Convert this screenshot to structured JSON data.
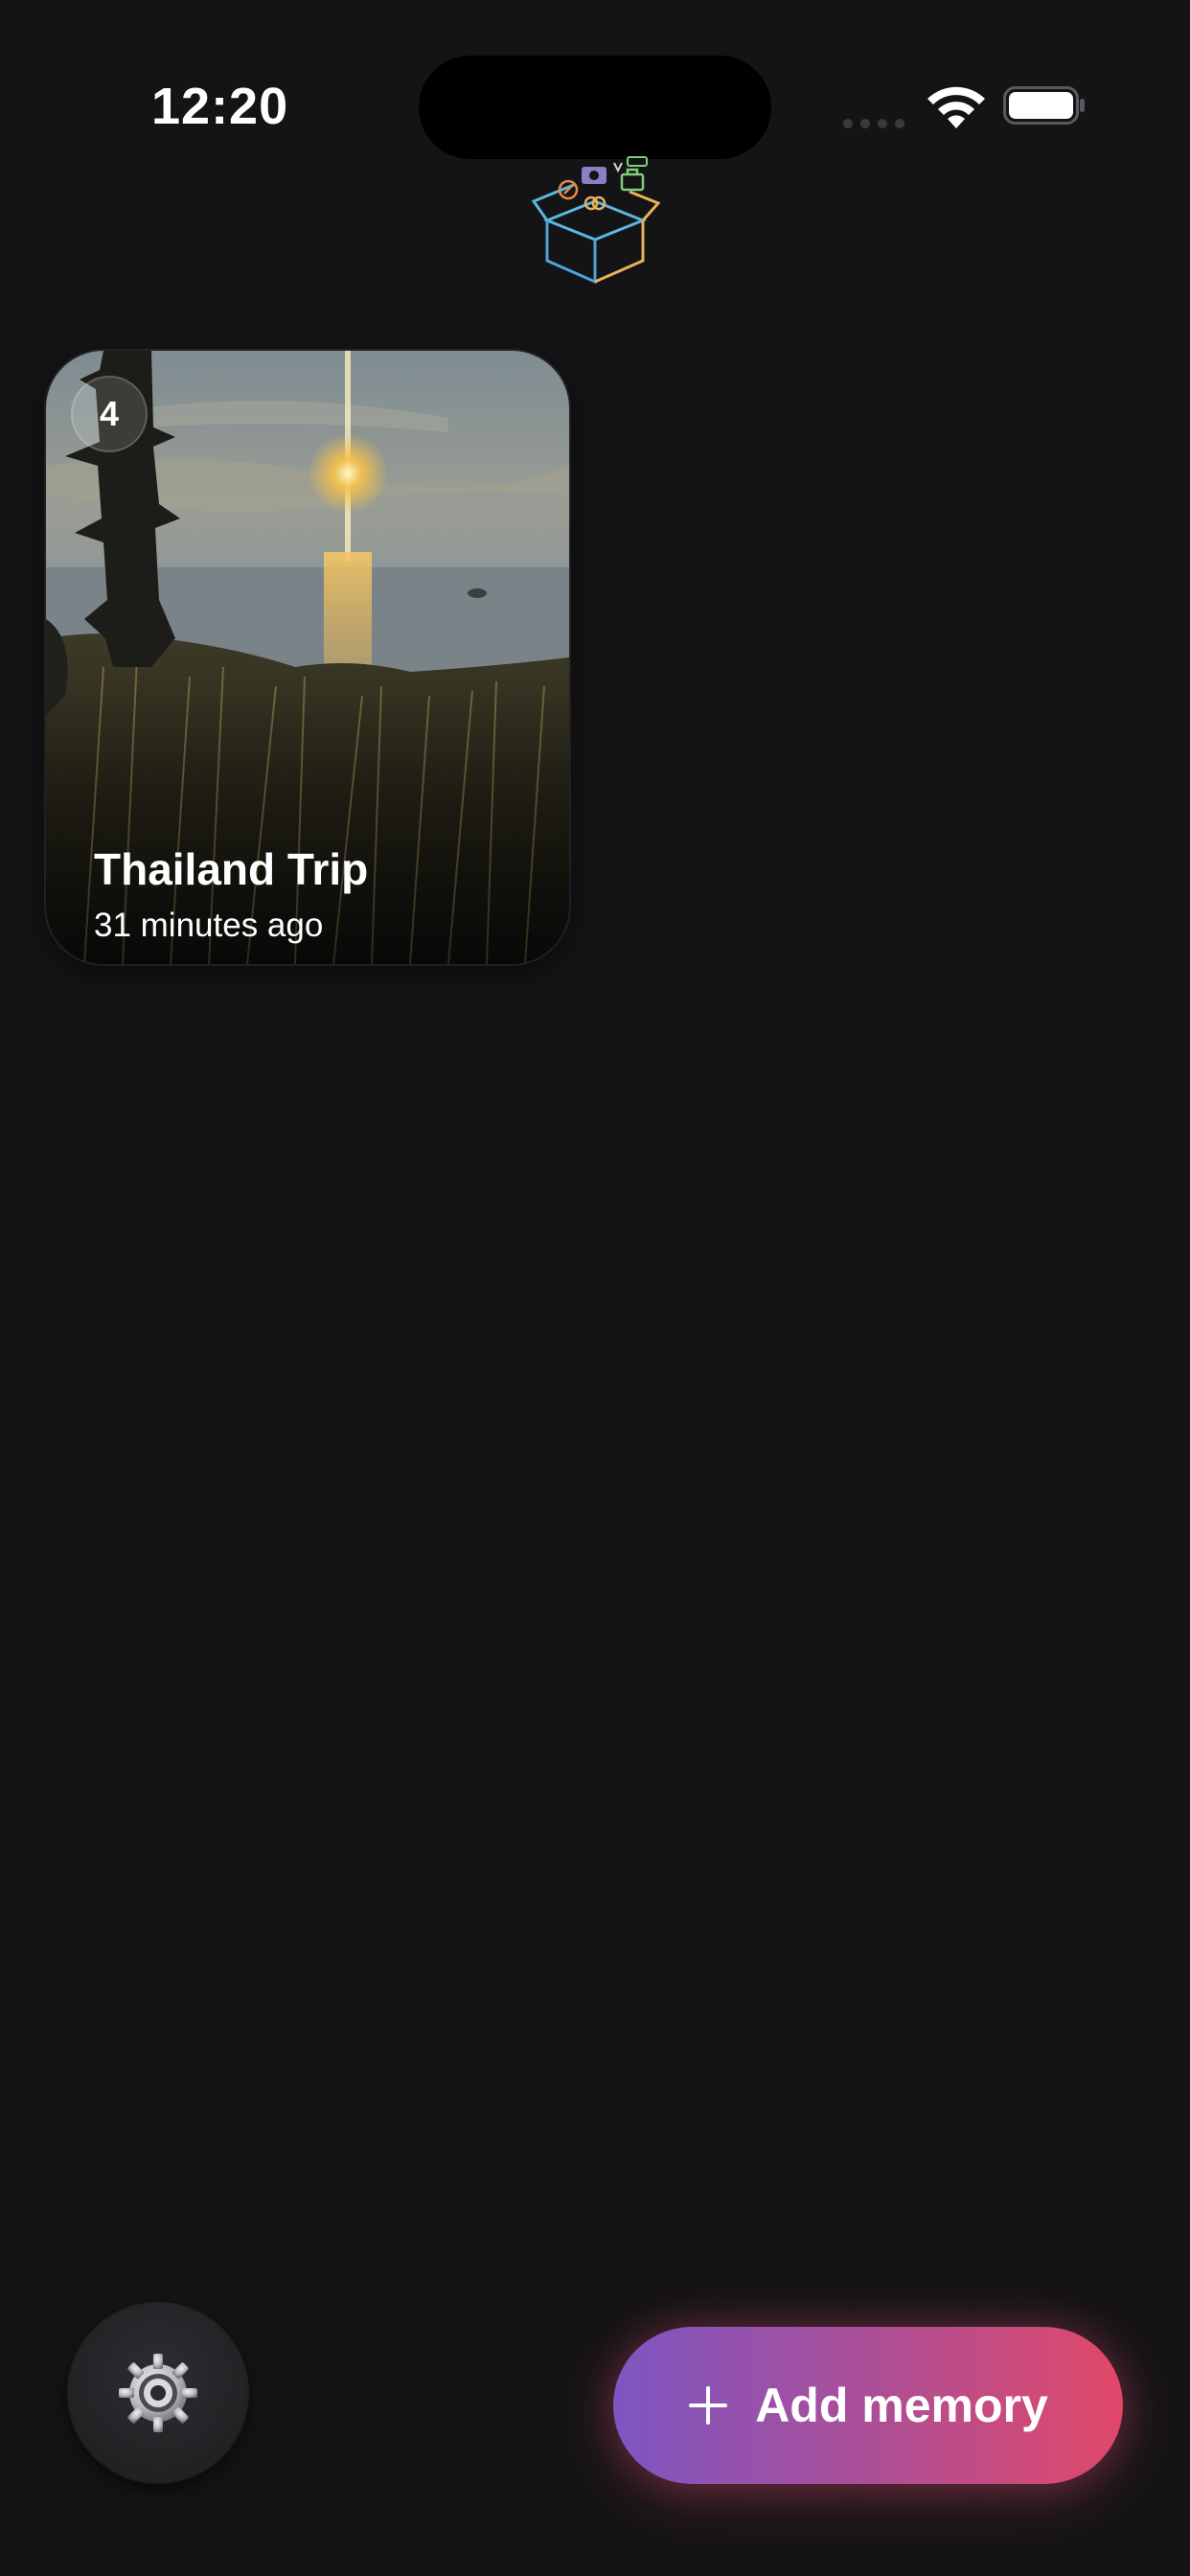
{
  "status_bar": {
    "time": "12:20"
  },
  "header": {
    "logo_icon": "memory-box-icon"
  },
  "memories": [
    {
      "title": "Thailand Trip",
      "subtitle": "31 minutes ago",
      "count": "4"
    }
  ],
  "toolbar": {
    "settings_icon": "gear-icon",
    "add_label": "Add memory",
    "add_icon": "plus-icon"
  },
  "colors": {
    "background": "#141416",
    "button_gradient_start": "#7d56c2",
    "button_gradient_end": "#e14868"
  }
}
